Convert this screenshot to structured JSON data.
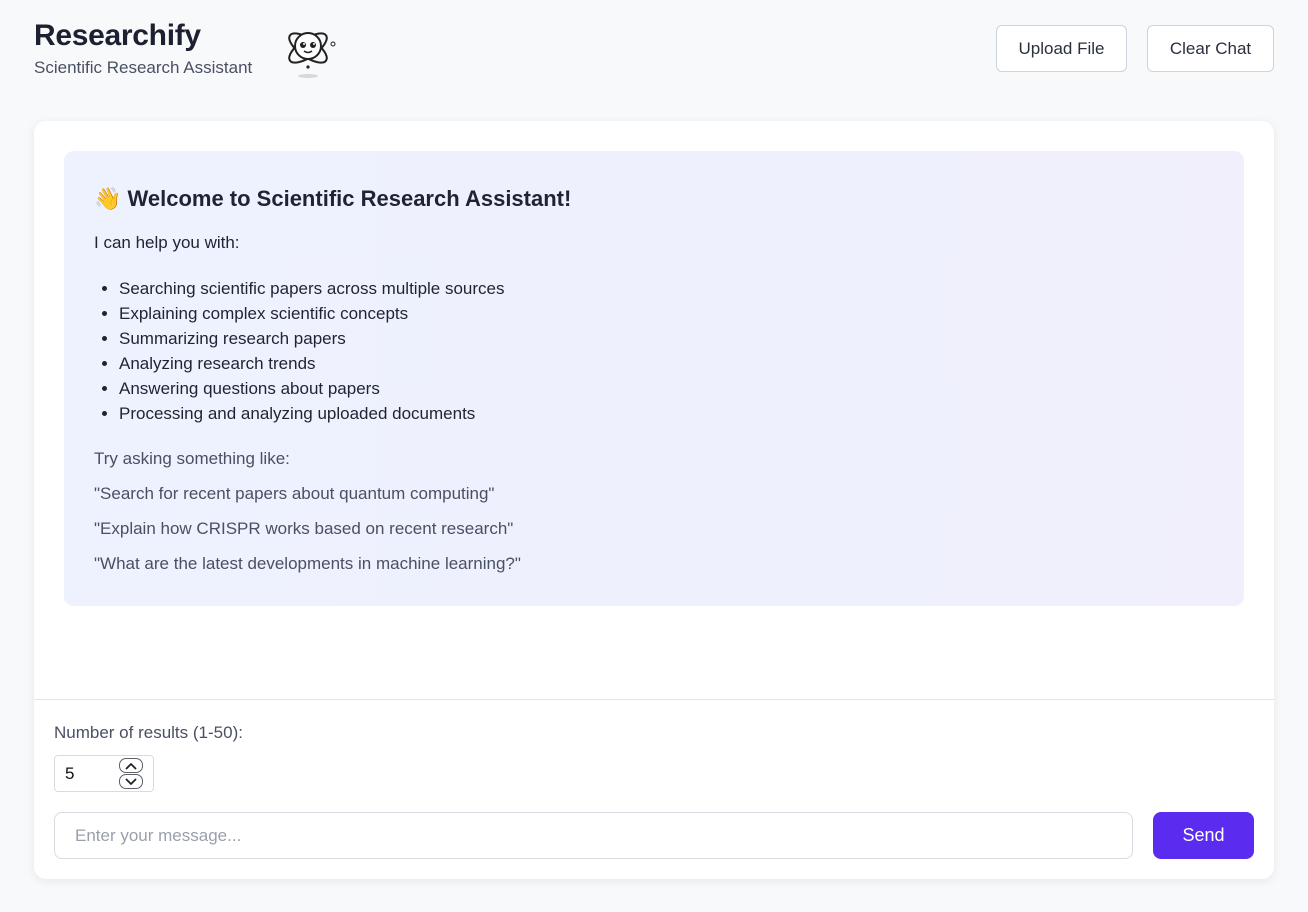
{
  "brand": {
    "title": "Researchify",
    "subtitle": "Scientific Research Assistant",
    "logo_icon": "atom-robot-icon"
  },
  "header": {
    "upload_label": "Upload File",
    "clear_label": "Clear Chat"
  },
  "welcome": {
    "title": "👋 Welcome to Scientific Research Assistant!",
    "intro": "I can help you with:",
    "items": [
      "Searching scientific papers across multiple sources",
      "Explaining complex scientific concepts",
      "Summarizing research papers",
      "Analyzing research trends",
      "Answering questions about papers",
      "Processing and analyzing uploaded documents"
    ],
    "try_label": "Try asking something like:",
    "examples": [
      "\"Search for recent papers about quantum computing\"",
      "\"Explain how CRISPR works based on recent research\"",
      "\"What are the latest developments in machine learning?\""
    ]
  },
  "controls": {
    "results_label": "Number of results (1-50):",
    "results_value": "5",
    "message_placeholder": "Enter your message...",
    "send_label": "Send"
  },
  "colors": {
    "accent": "#5b2cf0",
    "welcome_bg": "#eef1fe",
    "page_bg": "#f8f9fb"
  }
}
